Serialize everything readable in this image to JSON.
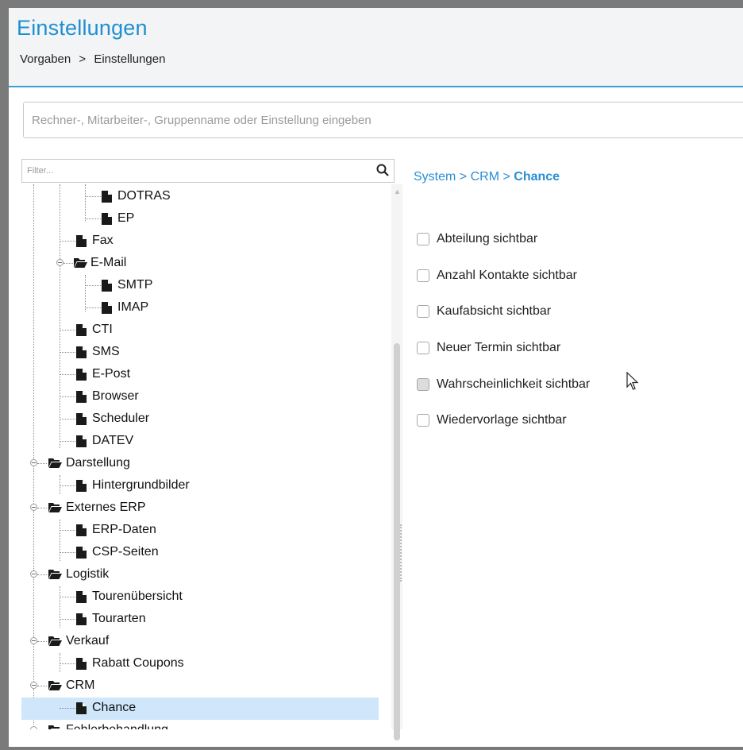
{
  "header": {
    "title": "Einstellungen",
    "breadcrumb": [
      "Vorgaben",
      ">",
      "Einstellungen"
    ]
  },
  "search": {
    "placeholder": "Rechner-, Mitarbeiter-, Gruppenname oder Einstellung eingeben"
  },
  "tree": {
    "filter_placeholder": "Filter...",
    "items": [
      {
        "label": "DOTRAS",
        "type": "file"
      },
      {
        "label": "EP",
        "type": "file"
      },
      {
        "label": "Fax",
        "type": "file"
      },
      {
        "label": "E-Mail",
        "type": "folder"
      },
      {
        "label": "SMTP",
        "type": "file"
      },
      {
        "label": "IMAP",
        "type": "file"
      },
      {
        "label": "CTI",
        "type": "file"
      },
      {
        "label": "SMS",
        "type": "file"
      },
      {
        "label": "E-Post",
        "type": "file"
      },
      {
        "label": "Browser",
        "type": "file"
      },
      {
        "label": "Scheduler",
        "type": "file"
      },
      {
        "label": "DATEV",
        "type": "file"
      },
      {
        "label": "Darstellung",
        "type": "folder"
      },
      {
        "label": "Hintergrundbilder",
        "type": "file"
      },
      {
        "label": "Externes ERP",
        "type": "folder"
      },
      {
        "label": "ERP-Daten",
        "type": "file"
      },
      {
        "label": "CSP-Seiten",
        "type": "file"
      },
      {
        "label": "Logistik",
        "type": "folder"
      },
      {
        "label": "Tourenübersicht",
        "type": "file"
      },
      {
        "label": "Tourarten",
        "type": "file"
      },
      {
        "label": "Verkauf",
        "type": "folder"
      },
      {
        "label": "Rabatt Coupons",
        "type": "file"
      },
      {
        "label": "CRM",
        "type": "folder"
      },
      {
        "label": "Chance",
        "type": "file",
        "selected": true
      },
      {
        "label": "Fehlerbehandlung",
        "type": "folder"
      }
    ]
  },
  "detail": {
    "path": {
      "parts": [
        "System",
        ">",
        "CRM",
        ">"
      ],
      "current": "Chance"
    },
    "options": [
      {
        "label": "Abteilung sichtbar",
        "checked": false
      },
      {
        "label": "Anzahl Kontakte sichtbar",
        "checked": false
      },
      {
        "label": "Kaufabsicht sichtbar",
        "checked": false
      },
      {
        "label": "Neuer Termin sichtbar",
        "checked": false
      },
      {
        "label": "Wahrscheinlichkeit sichtbar",
        "checked": false
      },
      {
        "label": "Wiedervorlage sichtbar",
        "checked": false
      }
    ]
  },
  "colors": {
    "accent": "#1e8fd0",
    "selection": "#cfe6fb",
    "header_bg": "#f2f4f6"
  }
}
